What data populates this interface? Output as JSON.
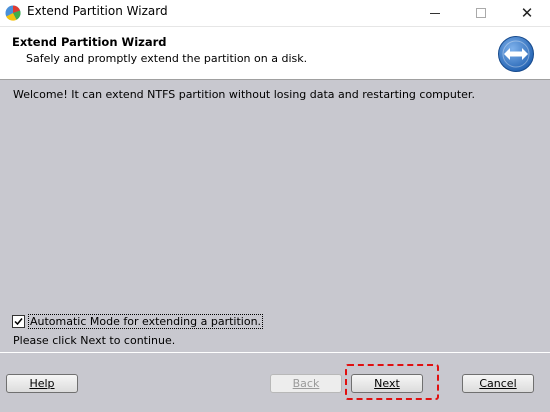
{
  "window": {
    "title": "Extend Partition Wizard",
    "icon": "partition-app-icon",
    "controls": [
      "minimize",
      "maximize",
      "close"
    ],
    "close_glyph": "✕"
  },
  "header": {
    "title": "Extend Partition Wizard",
    "subtitle": "Safely and promptly extend the partition on a disk.",
    "logo": "extend-arrows-icon"
  },
  "content": {
    "welcome": "Welcome! It can extend NTFS partition without losing data and restarting computer.",
    "auto_mode": {
      "label": "Automatic Mode for extending a partition.",
      "checked": true
    },
    "instruction": "Please click Next to continue."
  },
  "buttons": {
    "help": "Help",
    "back": "Back",
    "next": "Next",
    "cancel": "Cancel"
  },
  "colors": {
    "content_bg": "#c8c8cf",
    "highlight": "#e01010",
    "logo_blue": "#1f5fb0"
  }
}
